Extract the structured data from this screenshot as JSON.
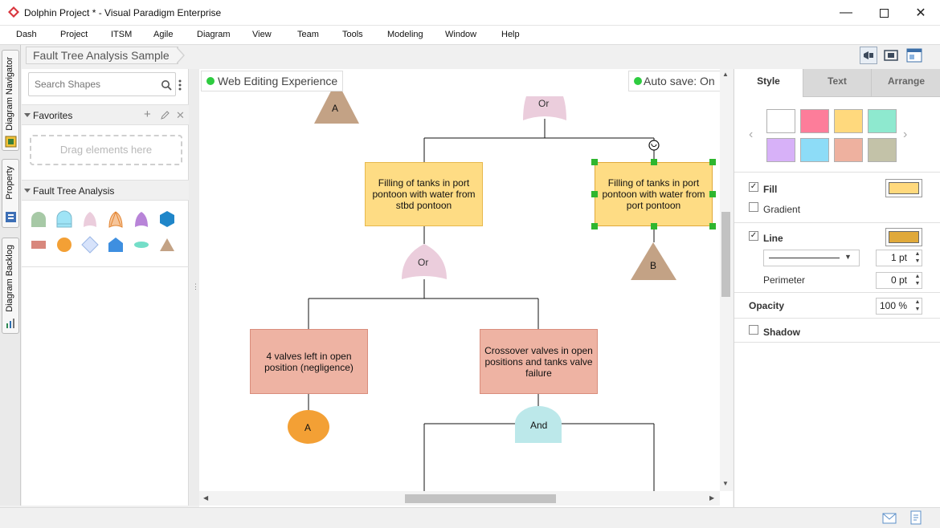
{
  "window": {
    "title": "Dolphin Project * - Visual Paradigm Enterprise"
  },
  "menu": [
    "Dash",
    "Project",
    "ITSM",
    "Agile",
    "Diagram",
    "View",
    "Team",
    "Tools",
    "Modeling",
    "Window",
    "Help"
  ],
  "vertical_tabs": [
    "Diagram Navigator",
    "Property",
    "Diagram Backlog"
  ],
  "breadcrumb": "Fault Tree Analysis Sample",
  "shapes_panel": {
    "search_placeholder": "Search Shapes",
    "favorites_title": "Favorites",
    "drop_hint": "Drag elements here",
    "fta_title": "Fault Tree Analysis"
  },
  "canvas": {
    "status_left": "Web Editing Experience",
    "status_right": "Auto save: On",
    "nodes": {
      "top_event_a": "A",
      "top_or": "Or",
      "box_stbd": "Filling of tanks in port pontoon with water from stbd pontoon",
      "box_port": "Filling of tanks in port pontoon with water from port pontoon",
      "mid_or": "Or",
      "transfer_b": "B",
      "box_valves": "4 valves left in open position (negligence)",
      "box_crossover": "Crossover valves in open positions and tanks valve failure",
      "circle_a": "A",
      "and_gate": "And"
    }
  },
  "right_panel": {
    "tabs": [
      "Style",
      "Text",
      "Arrange"
    ],
    "active_tab": "Style",
    "swatches": [
      "#ffffff",
      "#fd7d9a",
      "#ffd97d",
      "#8ee9cf",
      "#d7b1f8",
      "#8ddcf7",
      "#eeb19f",
      "#c3c2a8"
    ],
    "fill_label": "Fill",
    "fill_checked": true,
    "fill_color": "#ffd97d",
    "gradient_label": "Gradient",
    "gradient_checked": false,
    "line_label": "Line",
    "line_checked": true,
    "line_color": "#e0a93a",
    "line_width": "1 pt",
    "perimeter_label": "Perimeter",
    "perimeter_value": "0 pt",
    "opacity_label": "Opacity",
    "opacity_value": "100 %",
    "shadow_label": "Shadow",
    "shadow_checked": false
  }
}
